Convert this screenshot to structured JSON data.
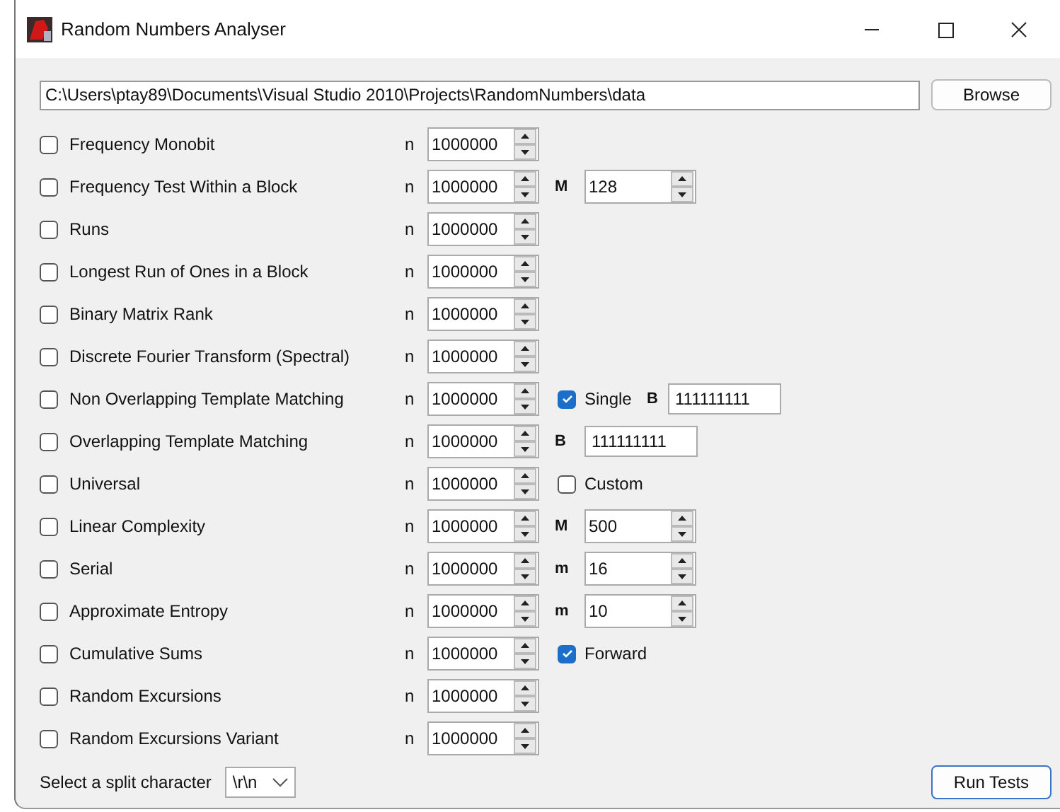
{
  "window": {
    "title": "Random Numbers Analyser"
  },
  "path": {
    "value": "C:\\Users\\ptay89\\Documents\\Visual Studio 2010\\Projects\\RandomNumbers\\data"
  },
  "browse_button": "Browse",
  "tests": [
    {
      "label": "Frequency Monobit",
      "checked": false,
      "n_label": "n",
      "n_value": "1000000"
    },
    {
      "label": "Frequency Test Within a Block",
      "checked": false,
      "n_label": "n",
      "n_value": "1000000",
      "extras": [
        {
          "kind": "spin",
          "label": "M",
          "value": "128"
        }
      ]
    },
    {
      "label": "Runs",
      "checked": false,
      "n_label": "n",
      "n_value": "1000000"
    },
    {
      "label": "Longest Run of Ones in a Block",
      "checked": false,
      "n_label": "n",
      "n_value": "1000000"
    },
    {
      "label": "Binary Matrix Rank",
      "checked": false,
      "n_label": "n",
      "n_value": "1000000"
    },
    {
      "label": "Discrete Fourier Transform (Spectral)",
      "checked": false,
      "n_label": "n",
      "n_value": "1000000"
    },
    {
      "label": "Non Overlapping Template Matching",
      "checked": false,
      "n_label": "n",
      "n_value": "1000000",
      "extras": [
        {
          "kind": "check",
          "label": "Single",
          "checked": true
        },
        {
          "kind": "text",
          "label": "B",
          "value": "111111111"
        }
      ]
    },
    {
      "label": "Overlapping Template Matching",
      "checked": false,
      "n_label": "n",
      "n_value": "1000000",
      "extras": [
        {
          "kind": "text",
          "label": "B",
          "value": "111111111"
        }
      ]
    },
    {
      "label": "Universal",
      "checked": false,
      "n_label": "n",
      "n_value": "1000000",
      "extras": [
        {
          "kind": "check",
          "label": "Custom",
          "checked": false
        }
      ]
    },
    {
      "label": "Linear Complexity",
      "checked": false,
      "n_label": "n",
      "n_value": "1000000",
      "extras": [
        {
          "kind": "spin",
          "label": "M",
          "value": "500"
        }
      ]
    },
    {
      "label": "Serial",
      "checked": false,
      "n_label": "n",
      "n_value": "1000000",
      "extras": [
        {
          "kind": "spin",
          "label": "m",
          "value": "16"
        }
      ]
    },
    {
      "label": "Approximate Entropy",
      "checked": false,
      "n_label": "n",
      "n_value": "1000000",
      "extras": [
        {
          "kind": "spin",
          "label": "m",
          "value": "10"
        }
      ]
    },
    {
      "label": "Cumulative Sums",
      "checked": false,
      "n_label": "n",
      "n_value": "1000000",
      "extras": [
        {
          "kind": "check",
          "label": "Forward",
          "checked": true
        }
      ]
    },
    {
      "label": "Random Excursions",
      "checked": false,
      "n_label": "n",
      "n_value": "1000000"
    },
    {
      "label": "Random Excursions Variant",
      "checked": false,
      "n_label": "n",
      "n_value": "1000000"
    }
  ],
  "split": {
    "label": "Select a split character",
    "value": "\\r\\n"
  },
  "run_button": "Run Tests"
}
